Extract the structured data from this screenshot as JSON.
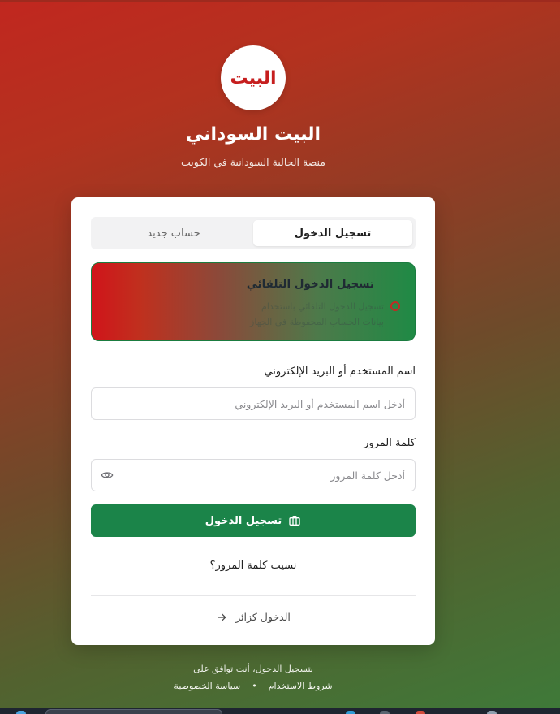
{
  "brand": {
    "logo_text": "البيت",
    "title": "البيت السوداني",
    "subtitle": "منصة الجالية السودانية في الكويت"
  },
  "tabs": [
    {
      "label": "تسجيل الدخول",
      "active": true
    },
    {
      "label": "حساب جديد",
      "active": false
    }
  ],
  "auto_login": {
    "title": "تسجيل الدخول التلقائي",
    "line1": "تسجيل الدخول التلقائي باستخدام",
    "line2": "بيانات الحساب المحفوظة في الجهاز"
  },
  "form": {
    "username_label": "اسم المستخدم أو البريد الإلكتروني",
    "username_placeholder": "أدخل اسم المستخدم أو البريد الإلكتروني",
    "password_label": "كلمة المرور",
    "password_placeholder": "أدخل كلمة المرور",
    "submit_label": "تسجيل الدخول",
    "forgot_label": "نسيت كلمة المرور؟",
    "guest_label": "الدخول كزائر"
  },
  "footer": {
    "agree_text": "بتسجيل الدخول، أنت توافق على",
    "terms_label": "شروط الاستخدام",
    "separator": "•",
    "privacy_label": "سياسة الخصوصية"
  },
  "colors": {
    "primary_green": "#1b8449",
    "brand_red": "#c61e1e"
  }
}
